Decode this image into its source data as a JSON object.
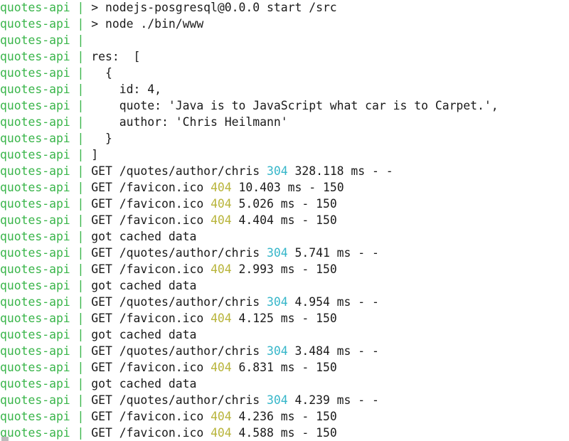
{
  "terminal": {
    "prefix": "quotes-api",
    "separator": " | ",
    "colors": {
      "prefix": "#39b54a",
      "text": "#1a1a1a",
      "status_304": "#35b6c9",
      "status_404": "#b8b43a",
      "background": "#ffffff"
    },
    "lines": [
      {
        "text": "> nodejs-posgresql@0.0.0 start /src"
      },
      {
        "text": "> node ./bin/www"
      },
      {
        "text": ""
      },
      {
        "text": "res:  ["
      },
      {
        "text": "  {"
      },
      {
        "text": "    id: 4,"
      },
      {
        "text": "    quote: 'Java is to JavaScript what car is to Carpet.',"
      },
      {
        "text": "    author: 'Chris Heilmann'"
      },
      {
        "text": "  }"
      },
      {
        "text": "]"
      },
      {
        "before": "GET /quotes/author/chris ",
        "status": "304",
        "after": " 328.118 ms - -"
      },
      {
        "before": "GET /favicon.ico ",
        "status": "404",
        "after": " 10.403 ms - 150"
      },
      {
        "before": "GET /favicon.ico ",
        "status": "404",
        "after": " 5.026 ms - 150"
      },
      {
        "before": "GET /favicon.ico ",
        "status": "404",
        "after": " 4.404 ms - 150"
      },
      {
        "text": "got cached data"
      },
      {
        "before": "GET /quotes/author/chris ",
        "status": "304",
        "after": " 5.741 ms - -"
      },
      {
        "before": "GET /favicon.ico ",
        "status": "404",
        "after": " 2.993 ms - 150"
      },
      {
        "text": "got cached data"
      },
      {
        "before": "GET /quotes/author/chris ",
        "status": "304",
        "after": " 4.954 ms - -"
      },
      {
        "before": "GET /favicon.ico ",
        "status": "404",
        "after": " 4.125 ms - 150"
      },
      {
        "text": "got cached data"
      },
      {
        "before": "GET /quotes/author/chris ",
        "status": "304",
        "after": " 3.484 ms - -"
      },
      {
        "before": "GET /favicon.ico ",
        "status": "404",
        "after": " 6.831 ms - 150"
      },
      {
        "text": "got cached data"
      },
      {
        "before": "GET /quotes/author/chris ",
        "status": "304",
        "after": " 4.239 ms - -"
      },
      {
        "before": "GET /favicon.ico ",
        "status": "404",
        "after": " 4.236 ms - 150"
      },
      {
        "before": "GET /favicon.ico ",
        "status": "404",
        "after": " 4.588 ms - 150"
      }
    ]
  }
}
